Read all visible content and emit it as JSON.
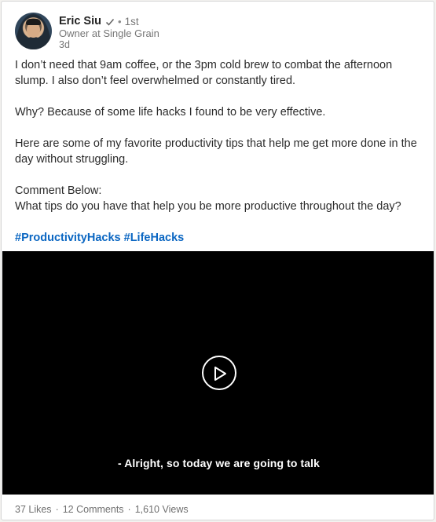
{
  "author": {
    "name": "Eric Siu",
    "separator": "•",
    "connection_degree": "1st",
    "headline": "Owner at Single Grain",
    "post_age": "3d",
    "verified_icon": "verified-check-icon"
  },
  "post": {
    "paragraphs": [
      "I don’t need that 9am coffee, or the 3pm cold brew to combat the afternoon slump.  I also don’t feel overwhelmed or constantly tired.",
      "Why?  Because of some life hacks I found to be very effective.",
      "Here are some of my favorite productivity tips that help me get more done in the day without struggling.",
      "Comment Below:",
      "What tips do you have that help you be more productive throughout the day?"
    ],
    "hashtags": [
      "#ProductivityHacks",
      "#LifeHacks"
    ]
  },
  "video": {
    "play_icon": "play-icon",
    "caption": "- Alright, so today we are going to talk"
  },
  "stats": {
    "likes": "37 Likes",
    "comments": "12 Comments",
    "views": "1,610 Views",
    "separator": "·"
  },
  "colors": {
    "link": "#0a66c2",
    "video_background": "#000000"
  }
}
